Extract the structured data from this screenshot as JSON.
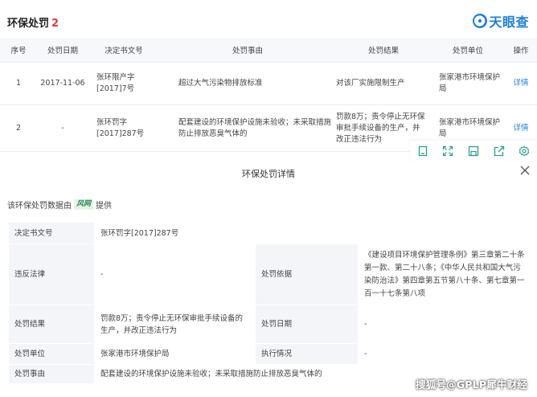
{
  "header": {
    "title": "环保处罚",
    "count": "2",
    "brand": "天眼查"
  },
  "columns": [
    "序号",
    "处罚日期",
    "决定书文号",
    "处罚事由",
    "处罚结果",
    "处罚单位",
    "操作"
  ],
  "rows": [
    {
      "no": "1",
      "date": "2017-11-06",
      "doc": "张环限产字[2017]7号",
      "reason": "超过大气污染物排放标准",
      "result": "对该厂实施限制生产",
      "unit": "张家港市环境保护局",
      "action": "详情"
    },
    {
      "no": "2",
      "date": "-",
      "doc": "张环罚字[2017]287号",
      "reason": "配套建设的环境保护设施未验收；未采取措施防止排放恶臭气体的",
      "result": "罚款8万；责令停止无环保审批手续设备的生产，并改正违法行为",
      "unit": "张家港市环境保护局",
      "action": "详情"
    }
  ],
  "toolbar": {
    "icons": [
      "copy-icon",
      "fullscreen-icon",
      "save-icon",
      "share-icon",
      "settings-icon"
    ]
  },
  "detail": {
    "title": "环保处罚详情",
    "source_prefix": "该环保处罚数据由",
    "source_logo": "风网",
    "source_suffix": "提供",
    "fields": {
      "doc_label": "决定书文号",
      "doc_value": "张环罚字[2017]287号",
      "law_label": "违反法律",
      "law_value": "-",
      "basis_label": "处罚依据",
      "basis_value": "《建设项目环境保护管理条例》第三章第二十条第一款、第二十八条；《中华人民共和国大气污染防治法》第四章第五节第八十条、第七章第一百一十七条第八项",
      "result_label": "处罚结果",
      "result_value": "罚款8万；责令停止无环保审批手续设备的生产，并改正违法行为",
      "date_label": "处罚日期",
      "date_value": "-",
      "unit_label": "处罚单位",
      "unit_value": "张家港市环境保护局",
      "exec_label": "执行情况",
      "exec_value": "-",
      "reason_label": "处罚事由",
      "reason_value": "配套建设的环境保护设施未验收；未采取措施防止排放恶臭气体的"
    }
  },
  "watermark": "搜狐号@GPLP犀牛财经",
  "colors": {
    "accent": "#1b80d6",
    "count": "#e4393c",
    "header_bg": "#f6f8fb",
    "key_bg": "#f3f5f8"
  }
}
